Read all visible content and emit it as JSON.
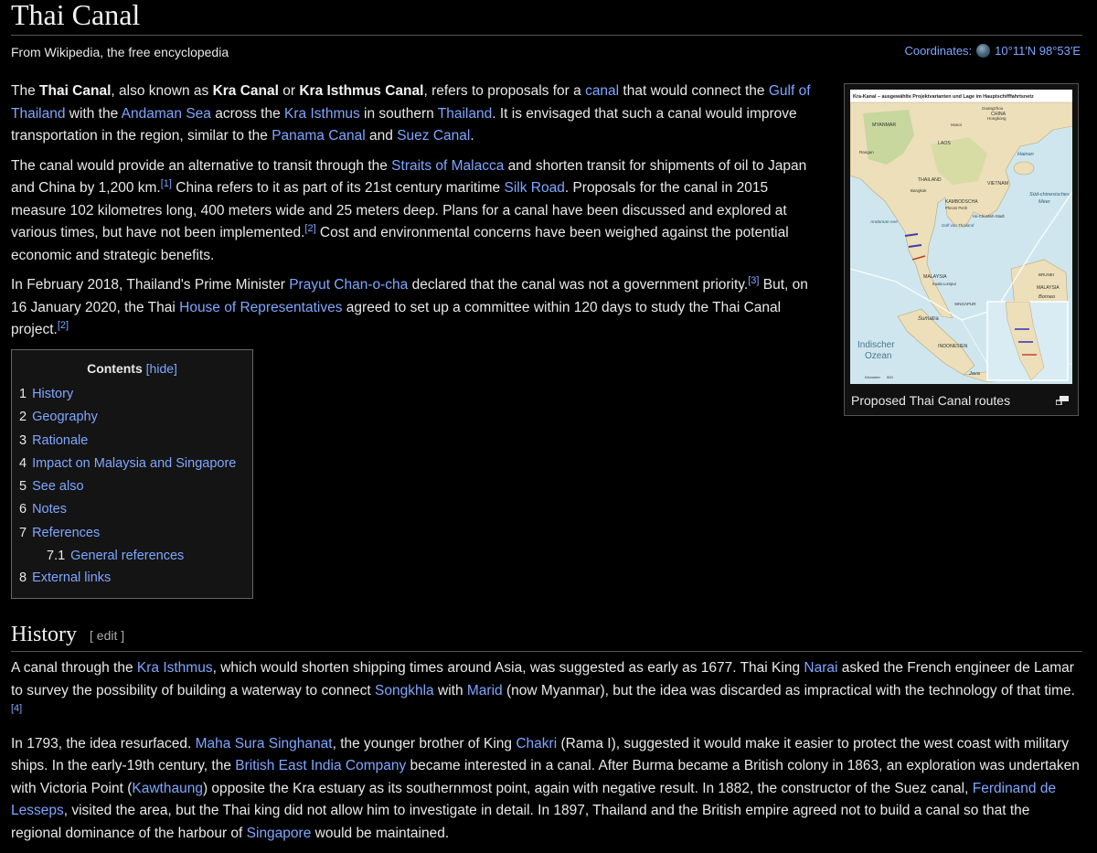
{
  "title": "Thai Canal",
  "tagline": "From Wikipedia, the free encyclopedia",
  "coordinates": {
    "label": "Coordinates:",
    "value": "10°11′N 98°53′E"
  },
  "lead": {
    "p1": {
      "t1": "The ",
      "b1": "Thai Canal",
      "t2": ", also known as ",
      "b2": "Kra Canal",
      "t3": " or ",
      "b3": "Kra Isthmus Canal",
      "t4": ", refers to proposals for a ",
      "l1": "canal",
      "t5": " that would connect the ",
      "l2": "Gulf of Thailand",
      "t6": " with the ",
      "l3": "Andaman Sea",
      "t7": " across the ",
      "l4": "Kra Isthmus",
      "t8": " in southern ",
      "l5": "Thailand",
      "t9": ". It is envisaged that such a canal would improve transportation in the region, similar to the ",
      "l6": "Panama Canal",
      "t10": " and ",
      "l7": "Suez Canal",
      "t11": "."
    },
    "p2": {
      "t1": "The canal would provide an alternative to transit through the ",
      "l1": "Straits of Malacca",
      "t2": " and shorten transit for shipments of oil to Japan and China by 1,200 km.",
      "r1": "[1]",
      "t3": " China refers to it as part of its 21st century maritime ",
      "l2": "Silk Road",
      "t4": ". Proposals for the canal in 2015 measure 102 kilometres long, 400 meters wide and 25 meters deep. Plans for a canal have been discussed and explored at various times, but have not been implemented.",
      "r2": "[2]",
      "t5": " Cost and environmental concerns have been weighed against the potential economic and strategic benefits."
    },
    "p3": {
      "t1": "In February 2018, Thailand's Prime Minister ",
      "l1": "Prayut Chan-o-cha",
      "t2": " declared that the canal was not a government priority.",
      "r1": "[3]",
      "t3": " But, on 16 January 2020, the Thai ",
      "l2": "House of Representatives",
      "t4": " agreed to set up a committee within 120 days to study the Thai Canal project.",
      "r2": "[2]"
    }
  },
  "infobox": {
    "caption": "Proposed Thai Canal routes",
    "map": {
      "heading": "Kra-Kanal – ausgewählte Projektvarianten und Lage im Hauptschifffahrtsnetz",
      "labels": {
        "china": "CHINA",
        "myanmar": "MYANMAR",
        "laos": "LAOS",
        "thailand": "THAILAND",
        "vietnam": "VIETNAM",
        "kambodscha": "KAMBODSCHA",
        "hainan": "Hainan",
        "sued": "Süd-chinesisches",
        "meer": "Meer",
        "andaman": "Andaman-see",
        "golf": "Golf von Thailand",
        "malaysia": "MALAYSIA",
        "malaysia2": "MALAYSIA",
        "borneo": "Borneo",
        "brunei": "BRUNEI",
        "singapur": "SINGAPUR",
        "sumatra": "Sumatra",
        "indonesien": "INDONESIEN",
        "indischer": "Indischer",
        "ozean": "Ozean",
        "java": "Java",
        "bangkok": "Bangkok",
        "hanoi": "Hanoi",
        "hongkong": "Hongkong",
        "guangzhou": "Guangzhou",
        "kualalumpur": "Kuala Lumpur",
        "phnompenh": "Phnom Penh",
        "hochiminh": "Ho-Chi-Minh-Stadt",
        "rangun": "Rangun",
        "km": "Kilometer",
        "kmv": "500"
      }
    }
  },
  "toc": {
    "title": "Contents",
    "hide": "[hide]",
    "items": [
      {
        "num": "1",
        "label": "History"
      },
      {
        "num": "2",
        "label": "Geography"
      },
      {
        "num": "3",
        "label": "Rationale"
      },
      {
        "num": "4",
        "label": "Impact on Malaysia and Singapore"
      },
      {
        "num": "5",
        "label": "See also"
      },
      {
        "num": "6",
        "label": "Notes"
      },
      {
        "num": "7",
        "label": "References"
      },
      {
        "num": "7.1",
        "label": "General references"
      },
      {
        "num": "8",
        "label": "External links"
      }
    ]
  },
  "history": {
    "heading": "History",
    "edit": "[ edit ]",
    "p1": {
      "t1": "A canal through the ",
      "l1": "Kra Isthmus",
      "t2": ", which would shorten shipping times around Asia, was suggested as early as 1677. Thai King ",
      "l2": "Narai",
      "t3": " asked the French engineer de Lamar to survey the possibility of building a waterway to connect ",
      "l3": "Songkhla",
      "t4": " with ",
      "l4": "Marid",
      "t5": " (now Myanmar), but the idea was discarded as impractical with the technology of that time.",
      "r1": "[4]"
    },
    "p2": {
      "t1": "In 1793, the idea resurfaced. ",
      "l1": "Maha Sura Singhanat",
      "t2": ", the younger brother of King ",
      "l2": "Chakri",
      "t3": " (Rama I), suggested it would make it easier to protect the west coast with military ships. In the early-19th century, the ",
      "l3": "British East India Company",
      "t4": " became interested in a canal. After Burma became a British colony in 1863, an exploration was undertaken with Victoria Point (",
      "l4": "Kawthaung",
      "t5": ") opposite the Kra estuary as its southernmost point, again with negative result. In 1882, the constructor of the Suez canal, ",
      "l5": "Ferdinand de Lesseps",
      "t6": ", visited the area, but the Thai king did not allow him to investigate in detail. In 1897, Thailand and the British empire agreed not to build a canal so that the regional dominance of the harbour of ",
      "l6": "Singapore",
      "t7": " would be maintained."
    }
  }
}
